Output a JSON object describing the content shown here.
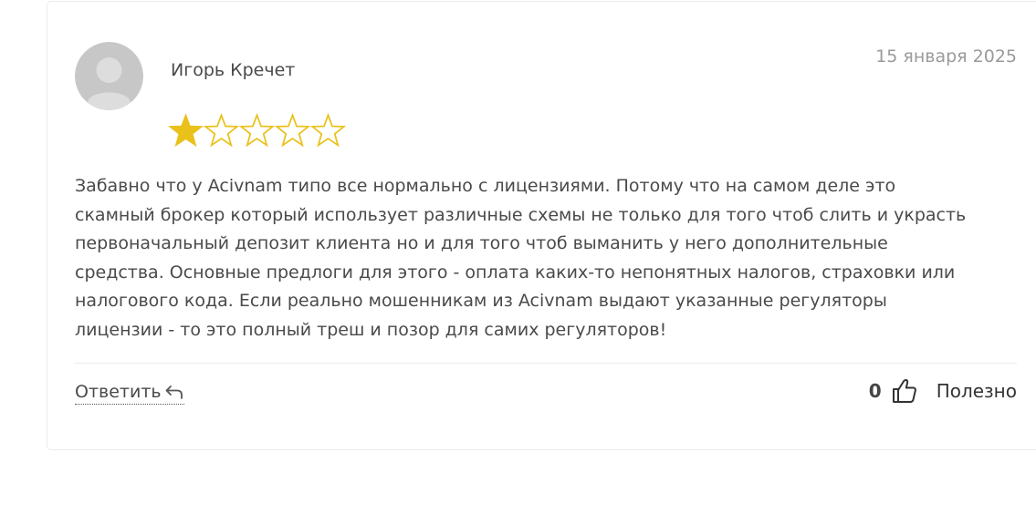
{
  "review": {
    "author": "Игорь Кречет",
    "date": "15 января 2025",
    "rating": 1,
    "rating_max": 5,
    "star_color": "#eac11b",
    "text": "Забавно что у Acivnam типо все нормально с лицензиями. Потому что на самом деле это скамный брокер который использует различные схемы не только для того чтоб слить и украсть первоначальный депозит клиента но и для того чтоб выманить у него дополнительные средства. Основные предлоги для этого - оплата каких-то непонятных налогов, страховки или налогового кода. Если реально мошенникам из Acivnam выдают указанные регуляторы лицензии - то это полный треш и позор для самих регуляторов!"
  },
  "actions": {
    "reply_label": "Ответить",
    "reply_icon": "reply-arrow-icon",
    "helpful_count": "0",
    "helpful_icon": "thumbs-up-icon",
    "helpful_label": "Полезно"
  },
  "avatar": {
    "icon": "default-user-avatar",
    "bg_color": "#c7c7c7",
    "fg_color": "#dddddd"
  }
}
